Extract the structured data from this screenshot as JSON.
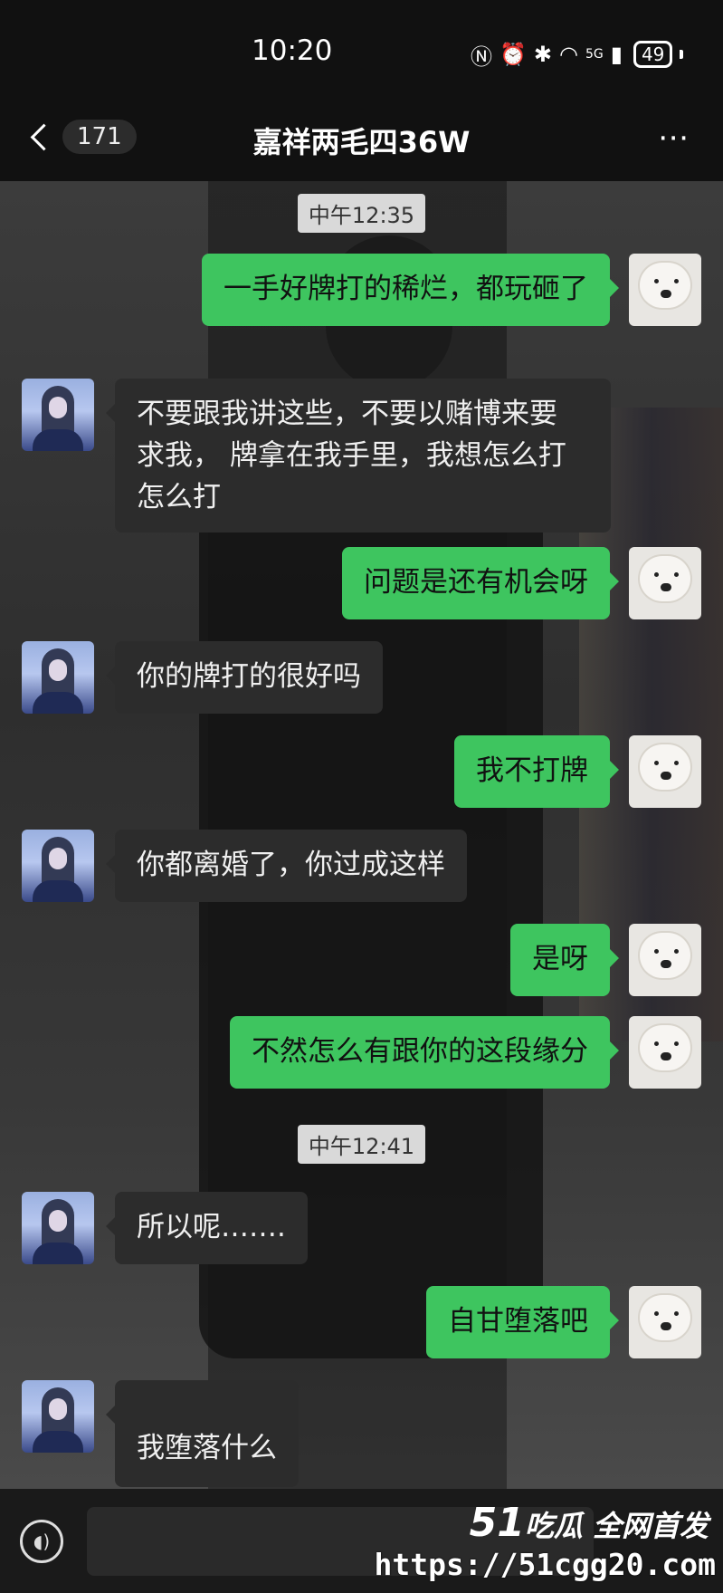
{
  "status_bar": {
    "time": "10:20",
    "battery": "49",
    "network": "5G"
  },
  "nav": {
    "unread_count": "171",
    "title": "嘉祥两毛四36W",
    "more": "⋯"
  },
  "messages": [
    {
      "type": "timestamp",
      "text": "中午12:35"
    },
    {
      "type": "out",
      "text": "一手好牌打的稀烂，都玩砸了"
    },
    {
      "type": "in",
      "text": "不要跟我讲这些，不要以赌博来要求我，牌拿在我手里，我想怎么打怎么打"
    },
    {
      "type": "out",
      "text": "问题是还有机会呀"
    },
    {
      "type": "in",
      "text": "你的牌打的很好吗"
    },
    {
      "type": "out",
      "text": "我不打牌"
    },
    {
      "type": "in",
      "text": "你都离婚了，你过成这样"
    },
    {
      "type": "out",
      "text": "是呀"
    },
    {
      "type": "out",
      "text": "不然怎么有跟你的这段缘分"
    },
    {
      "type": "timestamp",
      "text": "中午12:41"
    },
    {
      "type": "in",
      "text": "所以呢……."
    },
    {
      "type": "out",
      "text": "自甘堕落吧"
    },
    {
      "type": "in",
      "text": "我堕落什么"
    }
  ],
  "bubble_lines": {
    "m2_line1": "不要跟我讲这些，不要以赌博来要",
    "m2_line2": "求我， 牌拿在我手里，我想怎么打",
    "m2_line3": "怎么打"
  },
  "watermark": {
    "brand_num": "51",
    "brand_text": "吃瓜 全网首发",
    "url": "https://51cgg20.com"
  },
  "colors": {
    "out_bubble": "#3ec55f",
    "in_bubble": "#2c2c2c",
    "accent": "#3ec55f"
  },
  "icons": [
    "back-chevron-icon",
    "more-icon",
    "voice-icon",
    "nfc-icon",
    "alarm-icon",
    "bluetooth-icon",
    "wifi-icon",
    "signal-icon",
    "battery-icon"
  ]
}
